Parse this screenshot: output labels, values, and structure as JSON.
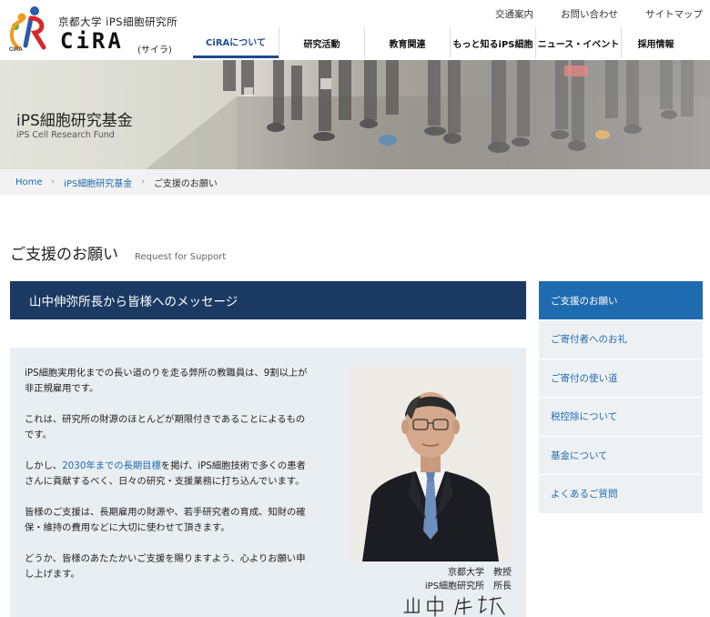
{
  "brand": {
    "university": "京都大学  iPS細胞研究所",
    "name": "CiRA",
    "kana": "(サイラ)",
    "mark_text": "CiRA",
    "colors": {
      "orange": "#f39a1e",
      "green": "#5fb336",
      "blue": "#2a5ca8",
      "red": "#d9262d"
    }
  },
  "util_nav": [
    "交通案内",
    "お問い合わせ",
    "サイトマップ"
  ],
  "main_nav": [
    {
      "label": "CiRAについて",
      "active": true
    },
    {
      "label": "研究活動"
    },
    {
      "label": "教育関連"
    },
    {
      "label": "もっと知るiPS細胞"
    },
    {
      "label": "ニュース・イベント"
    },
    {
      "label": "採用情報"
    }
  ],
  "hero": {
    "title": "iPS細胞研究基金",
    "subtitle": "iPS Cell Research Fund"
  },
  "breadcrumb": {
    "home": "Home",
    "parent": "iPS細胞研究基金",
    "current": "ご支援のお願い",
    "separator": "›"
  },
  "page": {
    "title": "ご支援のお願い",
    "title_en": "Request for Support"
  },
  "section": {
    "title": "山中伸弥所長から皆様へのメッセージ"
  },
  "message": {
    "p1": "iPS細胞実用化までの長い道のりを走る弊所の教職員は、9割以上が非正規雇用です。",
    "p2": "これは、研究所の財源のほとんどが期限付きであることによるものです。",
    "p3_pre": "しかし、",
    "p3_link": "2030年までの長期目標",
    "p3_post": "を掲げ、iPS細胞技術で多くの患者さんに貢献するべく、日々の研究・支援業務に打ち込んでいます。",
    "p4": "皆様のご支援は、長期雇用の財源や、若手研究者の育成、知財の確保・維持の費用などに大切に使わせて頂きます。",
    "p5": "どうか、皆様のあたたかいご支援を賜りますよう、心よりお願い申し上げます。"
  },
  "signature": {
    "line1": "京都大学　教授",
    "line2": "iPS細胞研究所　所長"
  },
  "sidebar": [
    {
      "label": "ご支援のお願い",
      "active": true
    },
    {
      "label": "ご寄付者へのお礼"
    },
    {
      "label": "ご寄付の使い道"
    },
    {
      "label": "税控除について"
    },
    {
      "label": "基金について"
    },
    {
      "label": "よくあるご質問"
    }
  ],
  "icons": {
    "breadcrumb_sep": "chevron-right-icon"
  }
}
